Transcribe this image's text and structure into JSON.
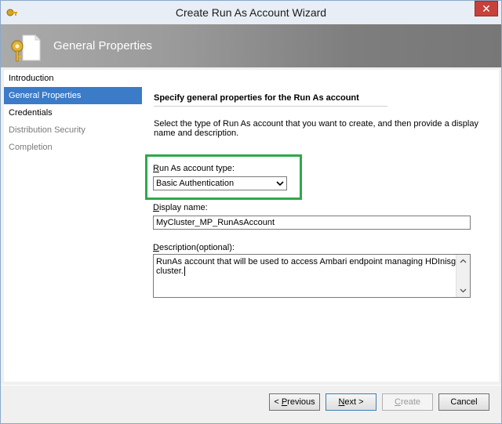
{
  "window": {
    "title": "Create Run As Account Wizard",
    "close_glyph": "✕"
  },
  "header": {
    "title": "General Properties",
    "icon": "key-document-icon"
  },
  "nav": {
    "items": [
      {
        "label": "Introduction",
        "state": "normal"
      },
      {
        "label": "General Properties",
        "state": "selected"
      },
      {
        "label": "Credentials",
        "state": "normal"
      },
      {
        "label": "Distribution Security",
        "state": "disabled"
      },
      {
        "label": "Completion",
        "state": "disabled"
      }
    ]
  },
  "content": {
    "section_title": "Specify general properties for the Run As account",
    "description": "Select the type of Run As account that you want to create, and then provide a display name and description.",
    "account_type": {
      "label_mnemonic": "R",
      "label_rest": "un As account type:",
      "value": "Basic Authentication"
    },
    "display_name": {
      "label_mnemonic": "D",
      "label_rest": "isplay name:",
      "value": "MyCluster_MP_RunAsAccount"
    },
    "description_field": {
      "label_mnemonic": "D",
      "label_rest": "escription(optional):",
      "value": "RunAs account that will be used to access Ambari endpoint managing HDInisght cluster."
    }
  },
  "buttons": {
    "previous": {
      "prefix": "< ",
      "mnemonic": "P",
      "rest": "revious"
    },
    "next": {
      "mnemonic": "N",
      "rest": "ext >"
    },
    "create": {
      "mnemonic": "C",
      "rest": "reate"
    },
    "cancel": {
      "label": "Cancel"
    }
  },
  "colors": {
    "highlight": "#2fa84a",
    "selection": "#3b7bc8",
    "close": "#c7413a"
  }
}
